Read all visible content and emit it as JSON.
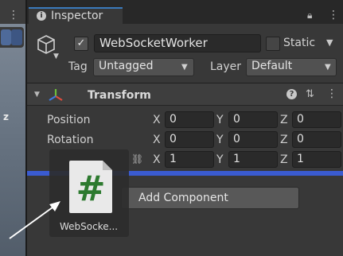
{
  "tab": {
    "title": "Inspector",
    "icon": "info-icon"
  },
  "scene": {
    "axis_label": "z"
  },
  "gameobject": {
    "active": true,
    "name": "WebSocketWorker",
    "static_label": "Static",
    "static": false,
    "tag_label": "Tag",
    "tag_value": "Untagged",
    "layer_label": "Layer",
    "layer_value": "Default"
  },
  "transform": {
    "title": "Transform",
    "rows": [
      {
        "label": "Position",
        "x": "0",
        "y": "0",
        "z": "0"
      },
      {
        "label": "Rotation",
        "x": "0",
        "y": "0",
        "z": "0"
      },
      {
        "label": "",
        "x": "1",
        "y": "1",
        "z": "1"
      }
    ],
    "axis_x": "X",
    "axis_y": "Y",
    "axis_z": "Z"
  },
  "add_component_label": "Add Component",
  "drag": {
    "label": "WebSocke...",
    "icon_glyph": "#"
  },
  "colors": {
    "accent": "#3a79bb",
    "drop_highlight": "#3a5bd0",
    "script_icon_green": "#2d7a2f"
  }
}
